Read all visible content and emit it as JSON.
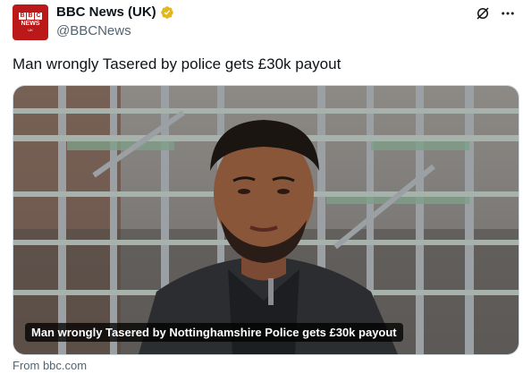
{
  "author": {
    "logo_text": "BBC",
    "logo_sub": "NEWS",
    "logo_region": "UK",
    "name": "BBC News (UK)",
    "handle": "@BBCNews"
  },
  "tweet": {
    "text": "Man wrongly Tasered by police gets £30k payout"
  },
  "card": {
    "caption": "Man wrongly Tasered by Nottinghamshire Police gets £30k payout",
    "source": "From bbc.com"
  },
  "icons": {
    "verified": "verified-badge-icon",
    "grok": "grok-icon",
    "more": "more-icon"
  },
  "colors": {
    "bbc_red": "#bb1919",
    "verified_gold": "#e2b719",
    "secondary_text": "#536471"
  }
}
